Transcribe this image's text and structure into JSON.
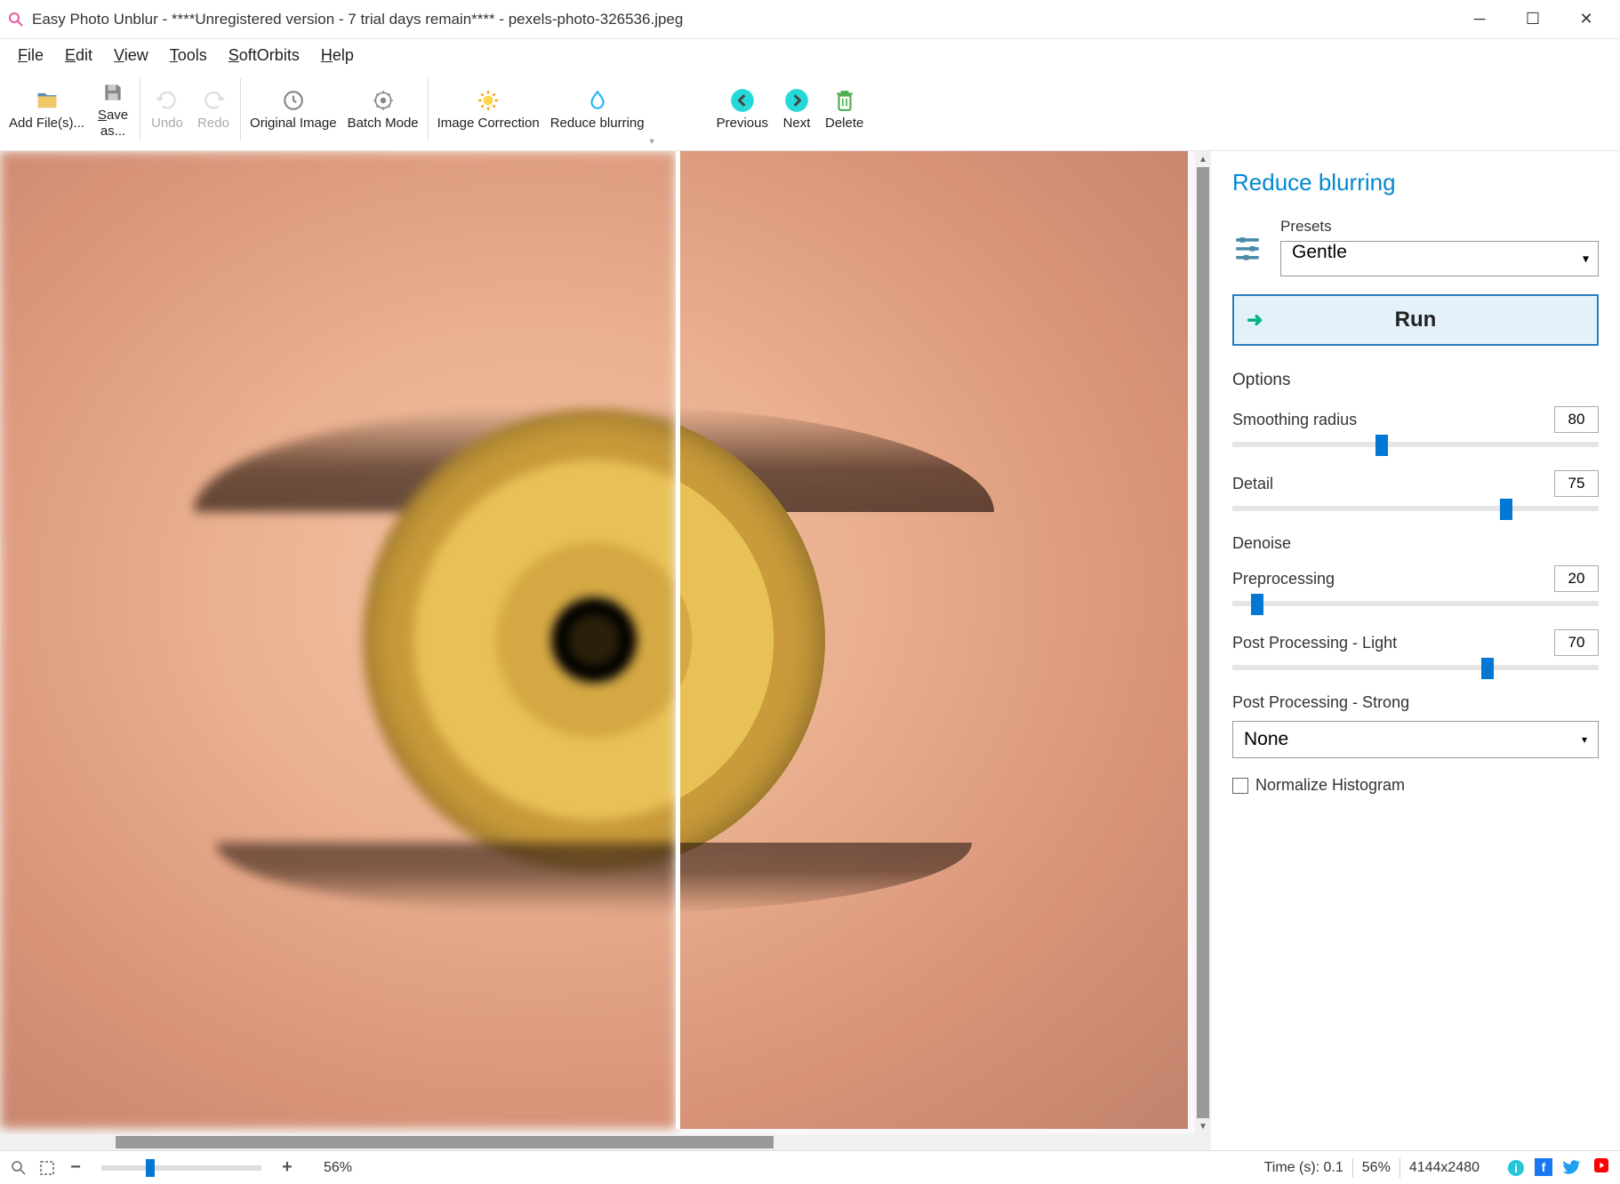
{
  "window": {
    "title": "Easy Photo Unblur - ****Unregistered version - 7 trial days remain**** - pexels-photo-326536.jpeg"
  },
  "menu": [
    "File",
    "Edit",
    "View",
    "Tools",
    "SoftOrbits",
    "Help"
  ],
  "toolbar": {
    "add": "Add File(s)...",
    "save": "Save as...",
    "undo": "Undo",
    "redo": "Redo",
    "original": "Original Image",
    "batch": "Batch Mode",
    "correction": "Image Correction",
    "reduce": "Reduce blurring",
    "previous": "Previous",
    "next": "Next",
    "delete": "Delete"
  },
  "panel": {
    "title": "Reduce blurring",
    "presets_label": "Presets",
    "preset_value": "Gentle",
    "run": "Run",
    "options": "Options",
    "smoothing_label": "Smoothing radius",
    "smoothing_value": "80",
    "smoothing_pct": 39,
    "detail_label": "Detail",
    "detail_value": "75",
    "detail_pct": 73,
    "denoise": "Denoise",
    "preprocessing_label": "Preprocessing",
    "preprocessing_value": "20",
    "preprocessing_pct": 5,
    "postlight_label": "Post Processing - Light",
    "postlight_value": "70",
    "postlight_pct": 68,
    "poststrong_label": "Post Processing - Strong",
    "poststrong_value": "None",
    "normalize": "Normalize Histogram"
  },
  "status": {
    "zoom": "56%",
    "time": "Time (s): 0.1",
    "zoom2": "56%",
    "dimensions": "4144x2480"
  }
}
